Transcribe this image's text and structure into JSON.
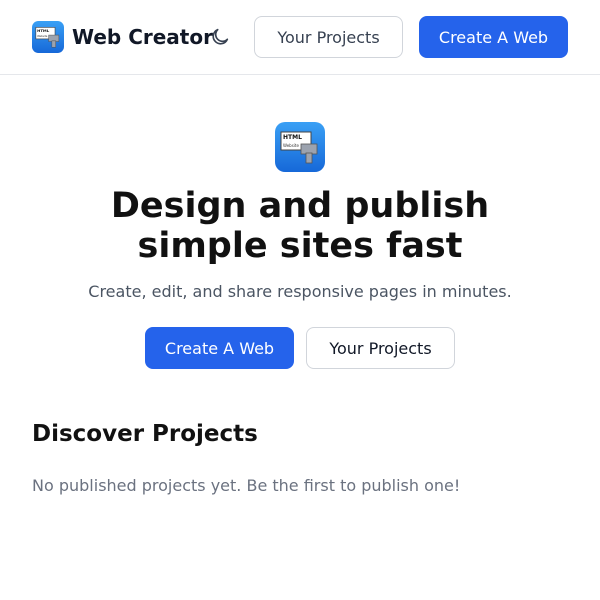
{
  "header": {
    "brand_name": "Web Creator",
    "brand_logo_icon": "html-website-app-icon",
    "theme_toggle_icon": "moon-icon",
    "projects_label": "Your Projects",
    "create_label": "Create A Web"
  },
  "logo": {
    "text_line1": "HTML",
    "text_line2": "Website"
  },
  "hero": {
    "title": "Design and publish simple sites fast",
    "subtitle": "Create, edit, and share responsive pages in minutes.",
    "create_label": "Create A Web",
    "projects_label": "Your Projects"
  },
  "discover": {
    "title": "Discover Projects",
    "empty_message": "No published projects yet. Be the first to publish one!"
  },
  "colors": {
    "primary": "#2563eb",
    "logo_gradient_top": "#3aa0f5",
    "logo_gradient_bottom": "#1668d8"
  }
}
